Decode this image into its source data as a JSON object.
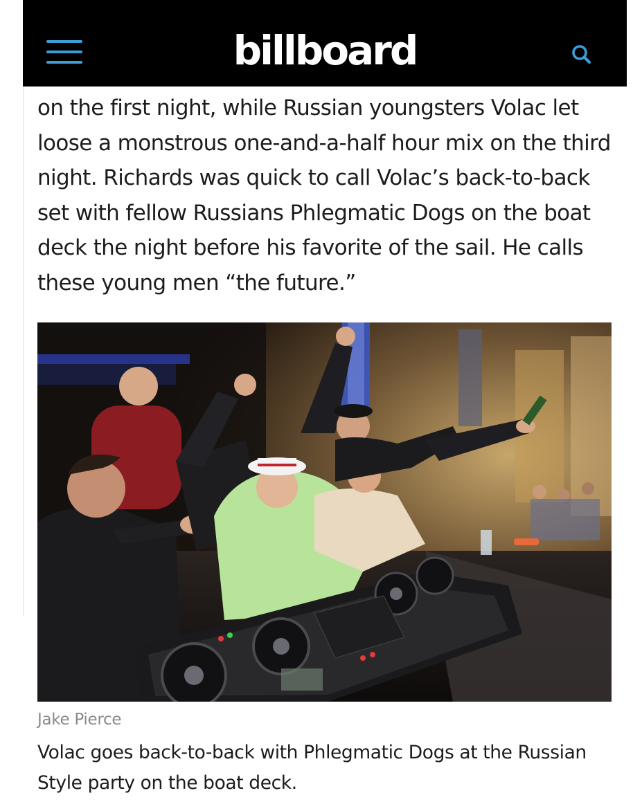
{
  "header": {
    "logo_text": "billboard",
    "menu_icon": "hamburger-menu-icon",
    "search_icon": "search-icon",
    "background_color": "#000000",
    "accent_color": "#3a9fd8"
  },
  "article": {
    "body_text": "on the first night, while Russian youngsters Volac let loose a monstrous one-and-a-half hour mix on the third night. Richards was quick to call Volac’s back-to-back set with fellow Russians Phlegmatic Dogs on the boat deck the night before his favorite of the sail. He calls these young men “the future.”"
  },
  "photo": {
    "credit": "Jake Pierce",
    "caption": "Volac goes back-to-back with Phlegmatic Dogs at the Russian Style party on the boat deck."
  }
}
